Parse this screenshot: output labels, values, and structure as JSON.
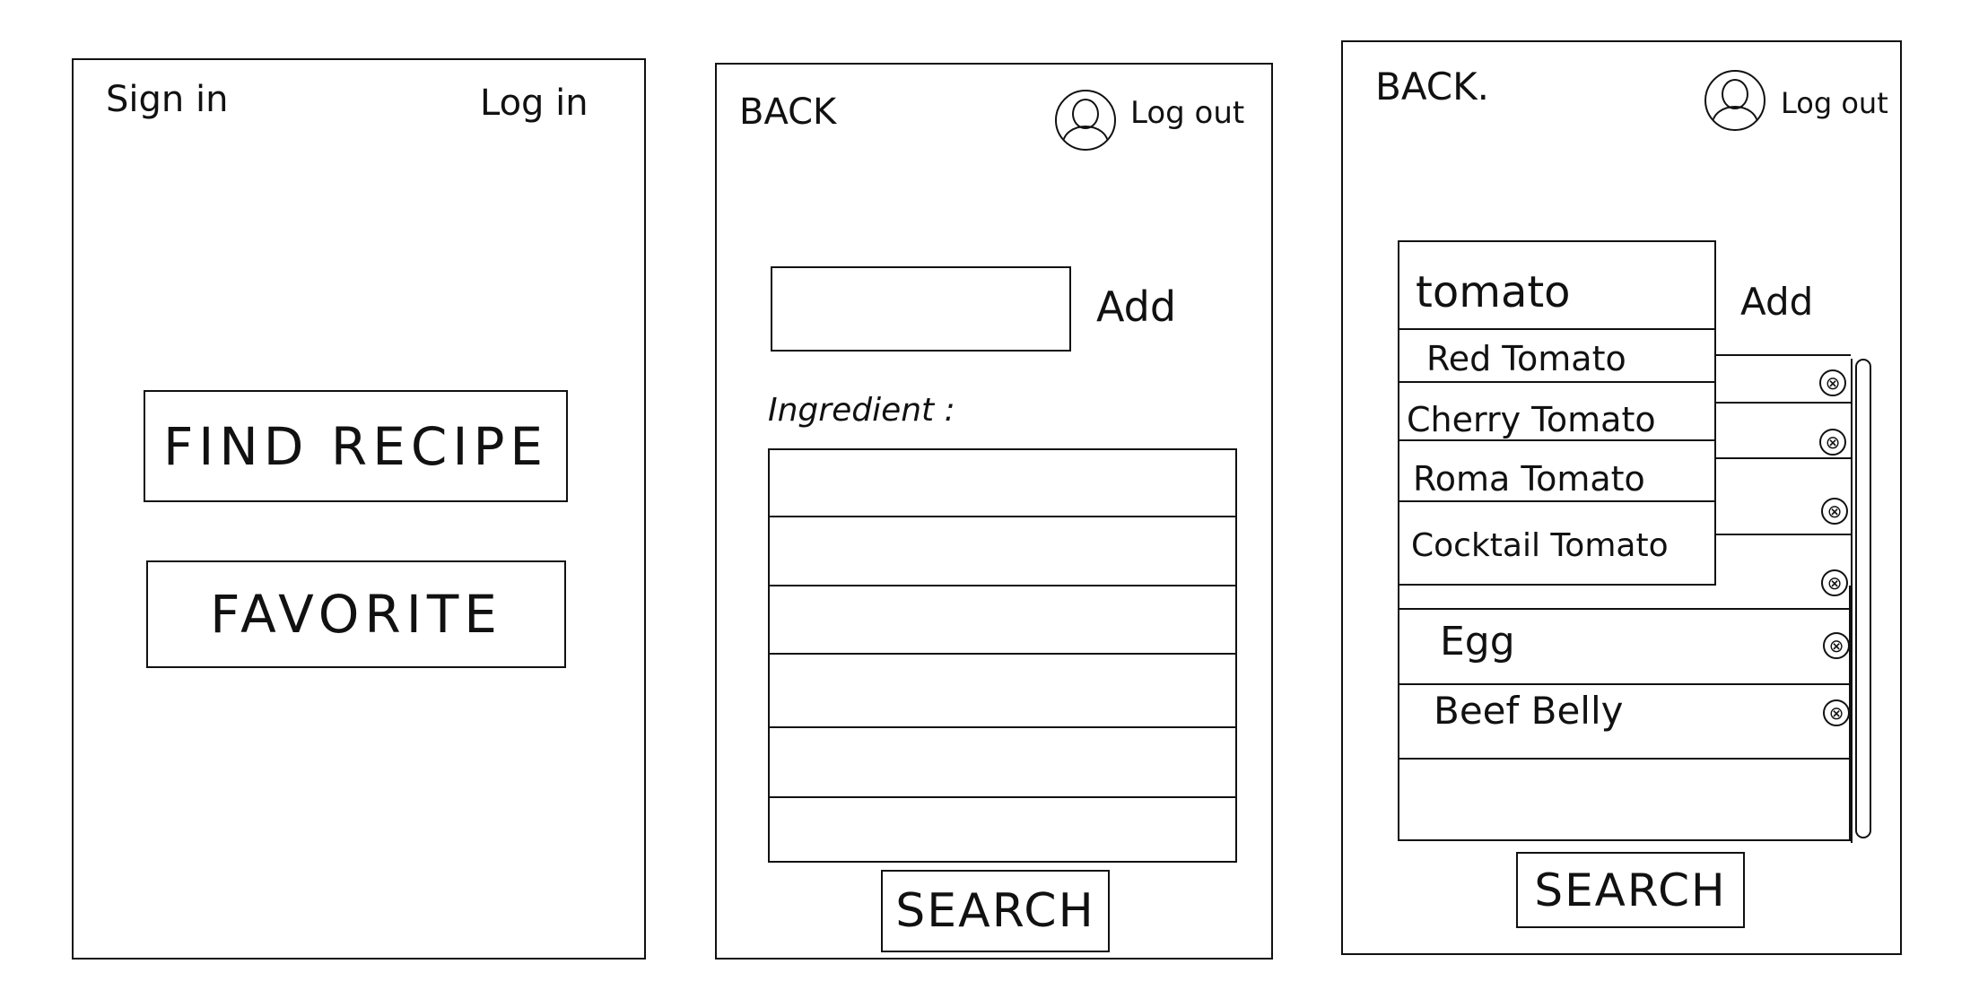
{
  "screen1": {
    "sign_in": "Sign in",
    "log_in": "Log in",
    "find_recipe": "FIND RECIPE",
    "favorite": "FAVORITE"
  },
  "screen2": {
    "back": "BACK",
    "logout": "Log out",
    "add": "Add",
    "ingredient_label": "Ingredient :",
    "ingredient_input": "",
    "search": "SEARCH"
  },
  "screen3": {
    "back": "BACK.",
    "logout": "Log out",
    "input_value": "tomato",
    "add": "Add",
    "suggestions": [
      "Red Tomato",
      "Cherry Tomato",
      "Roma Tomato",
      "Cocktail Tomato"
    ],
    "items": [
      "Egg",
      "Beef Belly"
    ],
    "remove_icon": "⊗",
    "search": "SEARCH"
  }
}
